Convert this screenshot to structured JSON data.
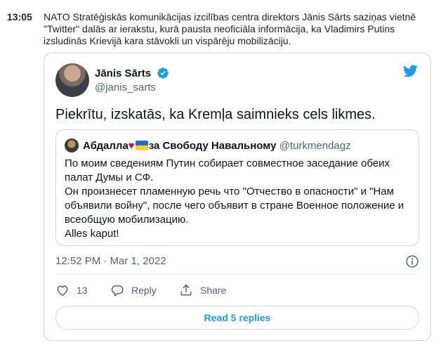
{
  "news": {
    "time": "13:05",
    "text": "NATO Stratēģiskās komunikācijas izcilības centra direktors Jānis Sārts saziņas vietnē \"Twitter\" dalās ar ierakstu, kurā pausta neoficiāla informācija, ka Vladimirs Putins izsludinās Krievijā kara stāvokli un vispārēju mobilizāciju."
  },
  "tweet": {
    "author_name": "Jānis Sārts",
    "author_handle": "@janis_sarts",
    "body": "Piekrītu, izskatās, ka Kremļa saimnieks cels likmes.",
    "timestamp": "12:52 PM · Mar 1, 2022",
    "likes": "13",
    "reply_label": "Reply",
    "share_label": "Share",
    "read_replies_label": "Read 5 replies",
    "accent_color": "#1d9bf0"
  },
  "quote": {
    "name_part1": "Абдалла",
    "name_part2": "за Свободу Навальному",
    "handle": "@turkmendagz",
    "lines": [
      "По моим сведениям Путин собирает совместное заседание обеих палат Думы и СФ.",
      "Он произнесет пламенную речь что \"Отчество в опасности\" и \"Нам объявили войну\", после чего объявит в стране Военное положение и всеобщую мобилизацию.",
      "Alles kaput!"
    ]
  },
  "icons": {
    "verified": "verified-badge-icon",
    "brand": "twitter-bird-icon",
    "info": "info-icon",
    "like": "heart-icon",
    "reply": "reply-bubble-icon",
    "share": "share-upload-icon"
  }
}
